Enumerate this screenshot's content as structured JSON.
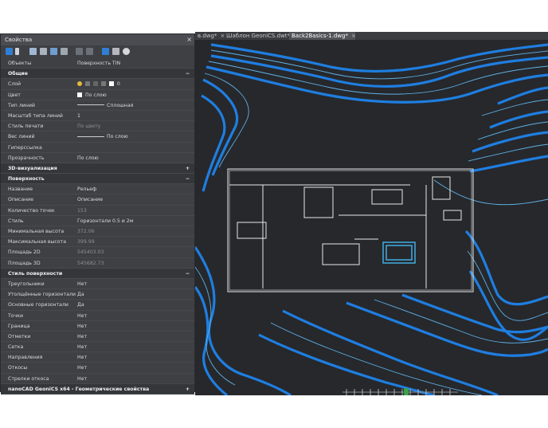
{
  "panel": {
    "title": "Свойства",
    "close": "×"
  },
  "tabs": [
    {
      "label": "в.dwg*",
      "close": "×"
    },
    {
      "label": "Шаблон GeoniCS.dwt*",
      "close": "×"
    },
    {
      "label": "Back2Basics-1.dwg*",
      "close": "×",
      "active": true
    }
  ],
  "object_row": {
    "label": "Объекты",
    "value": "Поверхность TIN"
  },
  "sections": {
    "general": {
      "title": "Общие",
      "toggle": "−"
    },
    "viz3d": {
      "title": "3D-визуализация",
      "toggle": "+"
    },
    "surface": {
      "title": "Поверхность",
      "toggle": "−"
    },
    "surface_style": {
      "title": "Стиль поверхности",
      "toggle": "−"
    },
    "geo": {
      "title": "nanoCAD GeoniCS x64 - Геометрические свойства",
      "toggle": "+"
    }
  },
  "general_rows": [
    {
      "label": "Слой",
      "value": "0",
      "kind": "layer"
    },
    {
      "label": "Цвет",
      "value": "По слою",
      "kind": "color"
    },
    {
      "label": "Тип линий",
      "value": "Сплошная",
      "kind": "line"
    },
    {
      "label": "Масштаб типа линий",
      "value": "1"
    },
    {
      "label": "Стиль печати",
      "value": "По цвету",
      "dim": true
    },
    {
      "label": "Вес линий",
      "value": "По слою",
      "kind": "line"
    },
    {
      "label": "Гиперссылка",
      "value": ""
    },
    {
      "label": "Прозрачность",
      "value": "По слою"
    }
  ],
  "surface_rows": [
    {
      "label": "Название",
      "value": "Рельеф"
    },
    {
      "label": "Описание",
      "value": "Описание"
    },
    {
      "label": "Количество точек",
      "value": "153",
      "dim": true
    },
    {
      "label": "Стиль",
      "value": "Горизонтали 0.5 и 2м"
    },
    {
      "label": "Минимальная высота",
      "value": "372.06",
      "dim": true
    },
    {
      "label": "Максимальная высота",
      "value": "399.99",
      "dim": true
    },
    {
      "label": "Площадь 2D",
      "value": "545403.03",
      "dim": true
    },
    {
      "label": "Площадь 3D",
      "value": "545682.73",
      "dim": true
    }
  ],
  "style_rows": [
    {
      "label": "Треугольники",
      "value": "Нет"
    },
    {
      "label": "Утолщённые горизонтали",
      "value": "Да"
    },
    {
      "label": "Основные горизонтали",
      "value": "Да"
    },
    {
      "label": "Точки",
      "value": "Нет"
    },
    {
      "label": "Граница",
      "value": "Нет"
    },
    {
      "label": "Отметки",
      "value": "Нет"
    },
    {
      "label": "Сетка",
      "value": "Нет"
    },
    {
      "label": "Направления",
      "value": "Нет"
    },
    {
      "label": "Откосы",
      "value": "Нет"
    },
    {
      "label": "Стрелки откоса",
      "value": "Нет"
    }
  ],
  "colors": {
    "canvas_bg": "#26282c",
    "contour_major": "#1f7ee0",
    "contour_minor": "#5fb2e8",
    "building": "#e8e8e8",
    "selected": "#43b6f0"
  }
}
